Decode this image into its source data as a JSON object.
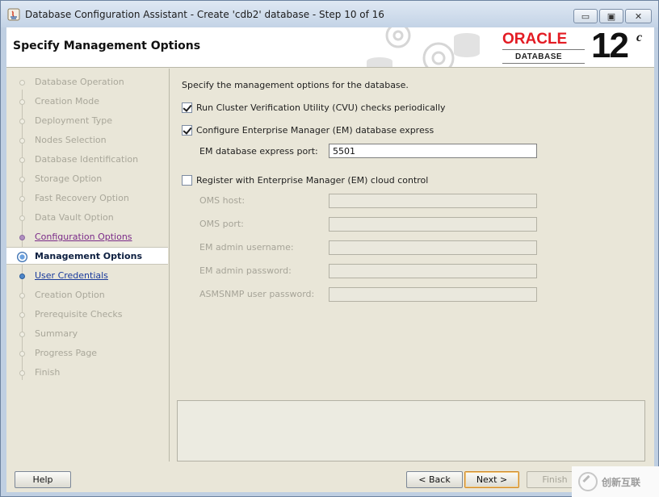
{
  "window": {
    "title": "Database Configuration Assistant - Create 'cdb2' database - Step 10 of 16",
    "minimize_glyph": "▭",
    "maximize_glyph": "▣",
    "close_glyph": "✕"
  },
  "header": {
    "page_title": "Specify Management Options",
    "brand": {
      "name": "ORACLE",
      "product": "DATABASE",
      "version": "12",
      "version_suffix": "c",
      "accent_color": "#e31b23"
    }
  },
  "steps": [
    {
      "label": "Database Operation",
      "state": "disabled"
    },
    {
      "label": "Creation Mode",
      "state": "disabled"
    },
    {
      "label": "Deployment Type",
      "state": "disabled"
    },
    {
      "label": "Nodes Selection",
      "state": "disabled"
    },
    {
      "label": "Database Identification",
      "state": "disabled"
    },
    {
      "label": "Storage Option",
      "state": "disabled"
    },
    {
      "label": "Fast Recovery Option",
      "state": "disabled"
    },
    {
      "label": "Data Vault Option",
      "state": "disabled"
    },
    {
      "label": "Configuration Options",
      "state": "visited"
    },
    {
      "label": "Management Options",
      "state": "current"
    },
    {
      "label": "User Credentials",
      "state": "link"
    },
    {
      "label": "Creation Option",
      "state": "disabled"
    },
    {
      "label": "Prerequisite Checks",
      "state": "disabled"
    },
    {
      "label": "Summary",
      "state": "disabled"
    },
    {
      "label": "Progress Page",
      "state": "disabled"
    },
    {
      "label": "Finish",
      "state": "disabled"
    }
  ],
  "main": {
    "intro": "Specify the management options for the database.",
    "cvu_checkbox": {
      "label": "Run Cluster Verification Utility (CVU) checks periodically",
      "checked": true
    },
    "em_express_checkbox": {
      "label": "Configure Enterprise Manager (EM) database express",
      "checked": true
    },
    "em_port": {
      "label": "EM database express port:",
      "value": "5501"
    },
    "cloud_control_checkbox": {
      "label": "Register with Enterprise Manager (EM) cloud control",
      "checked": false
    },
    "oms_host": {
      "label": "OMS host:",
      "value": ""
    },
    "oms_port": {
      "label": "OMS port:",
      "value": ""
    },
    "em_admin_username": {
      "label": "EM admin username:",
      "value": ""
    },
    "em_admin_password": {
      "label": "EM admin password:",
      "value": ""
    },
    "asmsnmp_password": {
      "label": "ASMSNMP user password:",
      "value": ""
    }
  },
  "buttons": {
    "help": "Help",
    "back": "< Back",
    "next": "Next >",
    "finish": "Finish"
  },
  "watermark": {
    "text": "创新互联"
  }
}
